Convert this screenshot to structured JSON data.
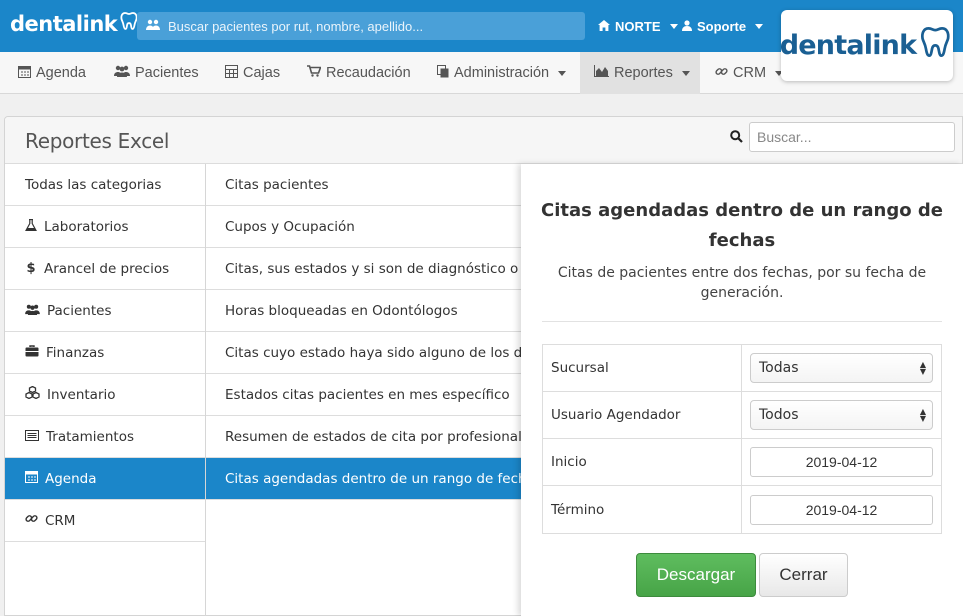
{
  "brand": {
    "name": "dentalink",
    "logo_card_name": "dentalink"
  },
  "topbar": {
    "search_placeholder": "Buscar pacientes por rut, nombre, apellido...",
    "branch": "NORTE",
    "user": "Soporte"
  },
  "menu": {
    "agenda": "Agenda",
    "pacientes": "Pacientes",
    "cajas": "Cajas",
    "recaudacion": "Recaudación",
    "administracion": "Administración",
    "reportes": "Reportes",
    "crm": "CRM"
  },
  "panel": {
    "title": "Reportes Excel",
    "search_placeholder": "Buscar..."
  },
  "categories": [
    {
      "label": "Todas las categorias",
      "icon": ""
    },
    {
      "label": "Laboratorios",
      "icon": "flask-icon"
    },
    {
      "label": "Arancel de precios",
      "icon": "dollar-icon"
    },
    {
      "label": "Pacientes",
      "icon": "users-icon"
    },
    {
      "label": "Finanzas",
      "icon": "briefcase-icon"
    },
    {
      "label": "Inventario",
      "icon": "cubes-icon"
    },
    {
      "label": "Tratamientos",
      "icon": "list-icon"
    },
    {
      "label": "Agenda",
      "icon": "calendar-icon"
    },
    {
      "label": "CRM",
      "icon": "link-icon"
    }
  ],
  "reports": [
    "Citas pacientes",
    "Cupos y Ocupación",
    "Citas, sus estados y si son de diagnóstico o tratamiento",
    "Horas bloqueadas en Odontólogos",
    "Citas cuyo estado haya sido alguno de los disponibles",
    "Estados citas pacientes en mes específico",
    "Resumen de estados de cita por profesional entre fechas",
    "Citas agendadas dentro de un rango de fechas"
  ],
  "form": {
    "title": "Citas agendadas dentro de un rango de fechas",
    "description": "Citas de pacientes entre dos fechas, por su fecha de generación.",
    "sucursal_label": "Sucursal",
    "sucursal_value": "Todas",
    "usuario_label": "Usuario Agendador",
    "usuario_value": "Todos",
    "inicio_label": "Inicio",
    "inicio_value": "2019-04-12",
    "termino_label": "Término",
    "termino_value": "2019-04-12",
    "download_label": "Descargar",
    "close_label": "Cerrar"
  },
  "colors": {
    "primary": "#1b86c9",
    "success": "#47a447",
    "logo_text": "#1a5f93"
  }
}
